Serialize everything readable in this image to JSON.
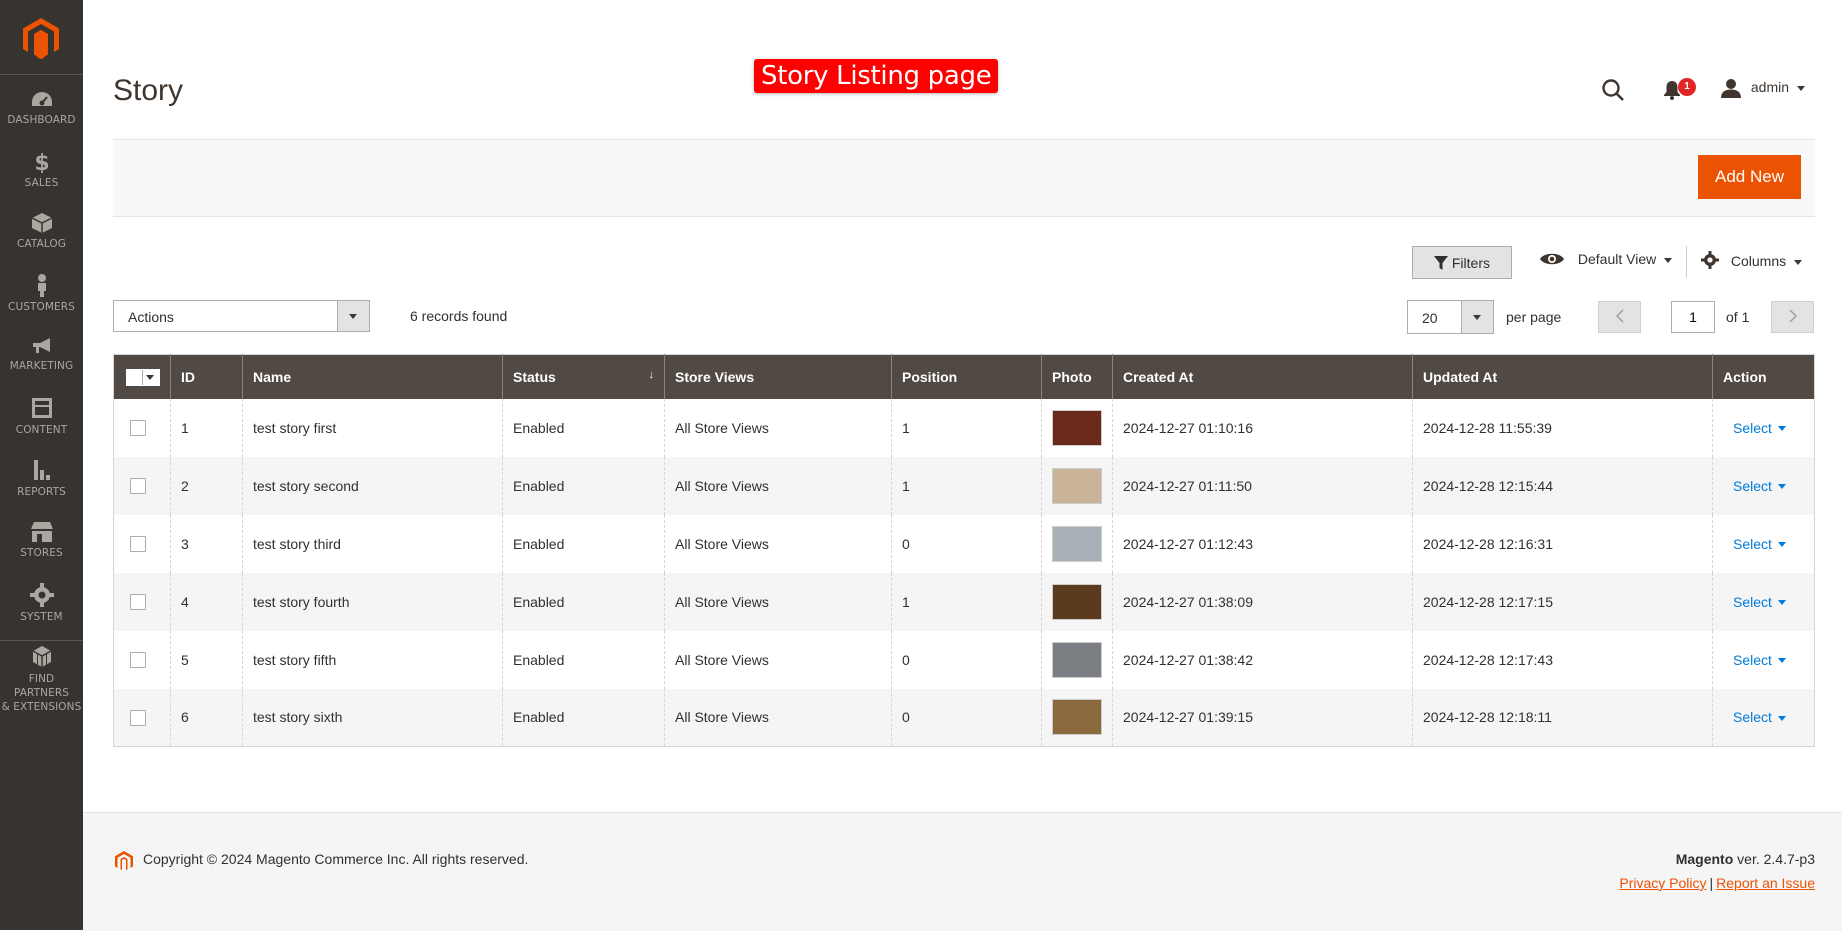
{
  "annotation": "Story Listing page",
  "sidebar": {
    "logo": "magento-logo",
    "items": [
      {
        "label": "DASHBOARD",
        "icon": "speedometer-icon"
      },
      {
        "label": "SALES",
        "icon": "dollar-icon"
      },
      {
        "label": "CATALOG",
        "icon": "box-icon"
      },
      {
        "label": "CUSTOMERS",
        "icon": "person-icon"
      },
      {
        "label": "MARKETING",
        "icon": "megaphone-icon"
      },
      {
        "label": "CONTENT",
        "icon": "layout-icon"
      },
      {
        "label": "REPORTS",
        "icon": "bar-chart-icon"
      },
      {
        "label": "STORES",
        "icon": "storefront-icon"
      },
      {
        "label": "SYSTEM",
        "icon": "gear-icon"
      },
      {
        "label": "FIND PARTNERS",
        "label2": "& EXTENSIONS",
        "icon": "cubes-icon"
      }
    ]
  },
  "header": {
    "title": "Story",
    "notifications_count": "1",
    "user": "admin"
  },
  "page_actions": {
    "add_new": "Add New"
  },
  "toolbar": {
    "filters": "Filters",
    "view": "Default View",
    "columns": "Columns",
    "actions": "Actions",
    "records": "6 records found",
    "per_page_value": "20",
    "per_page_label": "per page",
    "page": "1",
    "of_pages": "of 1"
  },
  "grid": {
    "columns": [
      "ID",
      "Name",
      "Status",
      "Store Views",
      "Position",
      "Photo",
      "Created At",
      "Updated At",
      "Action"
    ],
    "action_label": "Select",
    "rows": [
      {
        "id": "1",
        "name": "test story first",
        "status": "Enabled",
        "store": "All Store Views",
        "position": "1",
        "photo_color": "#6b2a1a",
        "created": "2024-12-27 01:10:16",
        "updated": "2024-12-28 11:55:39"
      },
      {
        "id": "2",
        "name": "test story second",
        "status": "Enabled",
        "store": "All Store Views",
        "position": "1",
        "photo_color": "#c9b49a",
        "created": "2024-12-27 01:11:50",
        "updated": "2024-12-28 12:15:44"
      },
      {
        "id": "3",
        "name": "test story third",
        "status": "Enabled",
        "store": "All Store Views",
        "position": "0",
        "photo_color": "#a8b0b8",
        "created": "2024-12-27 01:12:43",
        "updated": "2024-12-28 12:16:31"
      },
      {
        "id": "4",
        "name": "test story fourth",
        "status": "Enabled",
        "store": "All Store Views",
        "position": "1",
        "photo_color": "#5c3a1e",
        "created": "2024-12-27 01:38:09",
        "updated": "2024-12-28 12:17:15"
      },
      {
        "id": "5",
        "name": "test story fifth",
        "status": "Enabled",
        "store": "All Store Views",
        "position": "0",
        "photo_color": "#7b7f84",
        "created": "2024-12-27 01:38:42",
        "updated": "2024-12-28 12:17:43"
      },
      {
        "id": "6",
        "name": "test story sixth",
        "status": "Enabled",
        "store": "All Store Views",
        "position": "0",
        "photo_color": "#8a6a3c",
        "created": "2024-12-27 01:39:15",
        "updated": "2024-12-28 12:18:11"
      }
    ]
  },
  "footer": {
    "copyright": "Copyright © 2024 Magento Commerce Inc. All rights reserved.",
    "brand": "Magento",
    "version": " ver. 2.4.7-p3",
    "privacy": "Privacy Policy",
    "report": "Report an Issue",
    "link_sep": "|"
  },
  "colors": {
    "accent": "#eb5202",
    "sidebar": "#373330",
    "grid_header": "#514943",
    "link": "#007bdb",
    "annotation": "#ff0000"
  }
}
